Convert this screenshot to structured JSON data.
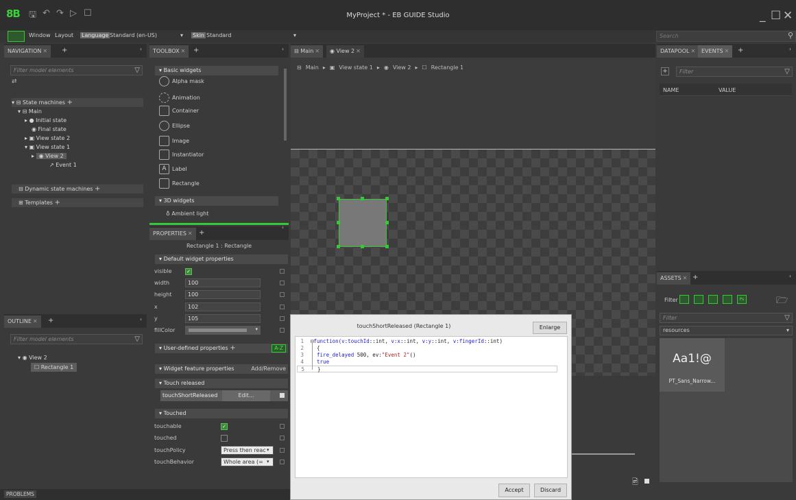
{
  "app": {
    "window_title": "MyProject * - EB GUIDE Studio",
    "logo": "8B"
  },
  "menubar": {
    "window": "Window",
    "layout": "Layout",
    "language_label": "Language",
    "language_value": "Standard (en-US)",
    "skin_label": "Skin",
    "skin_value": "Standard",
    "search_placeholder": "Search"
  },
  "navigation": {
    "tab": "NAVIGATION",
    "filter_placeholder": "Filter model elements",
    "state_machines": "State machines",
    "main": "Main",
    "initial_state": "Initial state",
    "final_state": "Final state",
    "view_state_2": "View state 2",
    "view_state_1": "View state 1",
    "view_2": "View 2",
    "event_1": "Event 1",
    "dynamic_state_machines": "Dynamic state machines",
    "templates": "Templates"
  },
  "outline": {
    "tab": "OUTLINE",
    "filter_placeholder": "Filter model elements",
    "view_2": "View 2",
    "rectangle_1": "Rectangle 1"
  },
  "problems_tab": "PROBLEMS",
  "toolbox": {
    "tab": "TOOLBOX",
    "basic_widgets": "Basic widgets",
    "items": [
      "Alpha mask",
      "Animation",
      "Container",
      "Ellipse",
      "Image",
      "Instantiator",
      "Label",
      "Rectangle"
    ],
    "widgets_3d": "3D widgets",
    "ambient_light": "Ambient light"
  },
  "properties": {
    "tab": "PROPERTIES",
    "subtitle": "Rectangle 1 : Rectangle",
    "default_section": "Default widget properties",
    "visible": "visible",
    "width": "width",
    "width_value": "100",
    "height": "height",
    "height_value": "100",
    "x": "x",
    "x_value": "102",
    "y": "y",
    "y_value": "105",
    "fillcolor": "fillColor",
    "user_defined": "User-defined properties",
    "az": "A-Z",
    "widget_feature": "Widget feature properties",
    "add_remove": "Add/Remove",
    "touch_released": "Touch released",
    "touch_short_released": "touchShortReleased",
    "edit": "Edit...",
    "touched_section": "Touched",
    "touchable": "touchable",
    "touched": "touched",
    "touch_policy": "touchPolicy",
    "touch_policy_value": "Press then reac",
    "touch_behavior": "touchBehavior",
    "touch_behavior_value": "Whole area (="
  },
  "editor_tabs": {
    "main": "Main",
    "view2": "View 2"
  },
  "breadcrumb": {
    "main": "Main",
    "view_state_1": "View state 1",
    "view_2": "View 2",
    "rectangle_1": "Rectangle 1"
  },
  "datapool": {
    "tab_datapool": "DATAPOOL",
    "tab_events": "EVENTS",
    "filter_placeholder": "Filter",
    "col_name": "NAME",
    "col_value": "VALUE"
  },
  "assets": {
    "tab": "ASSETS",
    "filter_label": "Filter",
    "filter_placeholder": "Filter",
    "resources": "resources",
    "font_preview": "Aa1!@",
    "font_name": "PT_Sans_Narrow..."
  },
  "dialog": {
    "title": "touchShortReleased (Rectangle 1)",
    "enlarge": "Enlarge",
    "accept": "Accept",
    "discard": "Discard",
    "lines": {
      "l1_fn": "function(",
      "l1_a": "v:touchId",
      "l1_b": "::int, ",
      "l1_c": "v:x",
      "l1_d": "::int, ",
      "l1_e": "v:y",
      "l1_f": "::int, ",
      "l1_g": "v:fingerId",
      "l1_h": "::int)",
      "l2": "{",
      "l3_a": "fire_delayed",
      "l3_b": " 500, ev:",
      "l3_c": "\"Event 2\"",
      "l3_d": "()",
      "l4": "true",
      "l5": "}"
    }
  }
}
